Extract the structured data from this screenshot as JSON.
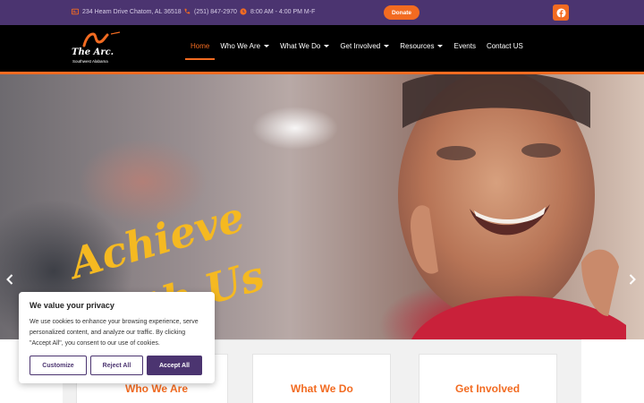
{
  "topbar": {
    "address": "234 Hearn Drive Chatom, AL 36518",
    "phone": "(251) 847-2970",
    "hours": "8:00 AM - 4:00 PM M-F",
    "donate_label": "Donate",
    "facebook_icon": "facebook-icon"
  },
  "logo": {
    "name": "The Arc.",
    "subtitle": "Southwest Alabama"
  },
  "nav": {
    "items": [
      {
        "label": "Home",
        "active": true,
        "dropdown": false
      },
      {
        "label": "Who We Are",
        "active": false,
        "dropdown": true
      },
      {
        "label": "What We Do",
        "active": false,
        "dropdown": true
      },
      {
        "label": "Get Involved",
        "active": false,
        "dropdown": true
      },
      {
        "label": "Resources",
        "active": false,
        "dropdown": true
      },
      {
        "label": "Events",
        "active": false,
        "dropdown": false
      },
      {
        "label": "Contact US",
        "active": false,
        "dropdown": false
      }
    ]
  },
  "hero": {
    "headline_line1": "Achieve",
    "headline_line2": "with Us",
    "prev_icon": "chevron-left-icon",
    "next_icon": "chevron-right-icon"
  },
  "cookie": {
    "title": "We value your privacy",
    "text": "We use cookies to enhance your browsing experience, serve personalized content, and analyze our traffic. By clicking \"Accept All\", you consent to our use of cookies.",
    "customize_label": "Customize",
    "reject_label": "Reject All",
    "accept_label": "Accept All"
  },
  "cards": [
    {
      "title": "Who We Are"
    },
    {
      "title": "What We Do"
    },
    {
      "title": "Get Involved"
    }
  ],
  "colors": {
    "brand_purple": "#4b3470",
    "brand_orange": "#f26b21",
    "headline_yellow": "#f5b921"
  }
}
